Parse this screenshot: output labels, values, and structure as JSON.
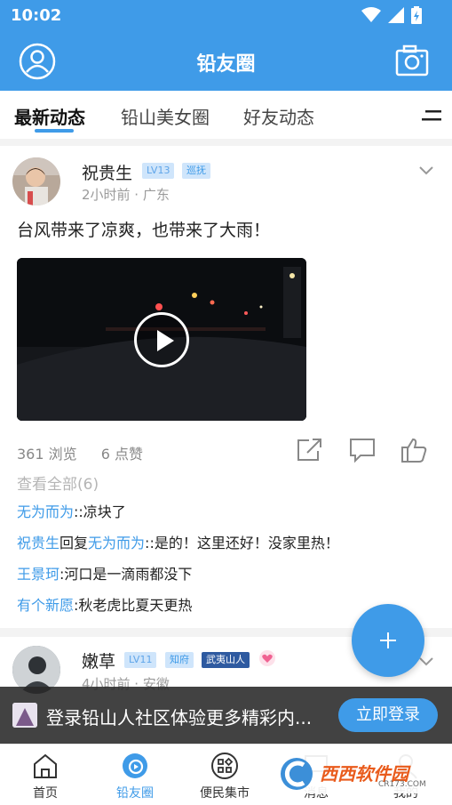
{
  "status": {
    "time": "10:02"
  },
  "header": {
    "title": "铅友圈"
  },
  "tabs": [
    {
      "label": "最新动态",
      "active": true
    },
    {
      "label": "铅山美女圈",
      "active": false
    },
    {
      "label": "好友动态",
      "active": false
    }
  ],
  "post": {
    "author": "祝贵生",
    "level": "LV13",
    "role": "巡抚",
    "meta": "2小时前 · 广东",
    "content": "台风带来了凉爽，也带来了大雨！",
    "views": "361 浏览",
    "likes": "6 点赞",
    "view_all": "查看全部(6)",
    "comments": [
      {
        "user": "无为而为",
        "text": "::凉块了"
      },
      {
        "user": "祝贵生",
        "reply_word": "回复",
        "reply_to": "无为而为",
        "text": "::是的！这里还好！没家里热！"
      },
      {
        "user": "王景珂",
        "text": ":河口是一滴雨都没下"
      },
      {
        "user": "有个新愿",
        "text": ":秋老虎比夏天更热"
      }
    ]
  },
  "post2": {
    "author": "嫩草",
    "level": "LV11",
    "role": "知府",
    "tag": "武夷山人",
    "meta": "4小时前 · 安徽"
  },
  "login_banner": {
    "text": "登录铅山人社区体验更多精彩内...",
    "button": "立即登录"
  },
  "bottom_nav": [
    {
      "label": "首页",
      "icon": "home-icon",
      "active": false
    },
    {
      "label": "铅友圈",
      "icon": "circle-icon",
      "active": true
    },
    {
      "label": "便民集市",
      "icon": "grid-icon",
      "active": false
    },
    {
      "label": "消息",
      "icon": "message-icon",
      "active": false
    },
    {
      "label": "我的",
      "icon": "profile-icon",
      "active": false
    }
  ],
  "watermark": {
    "text": "西西软件园",
    "sub": "CR173.COM"
  },
  "colors": {
    "accent": "#3f9be8"
  }
}
